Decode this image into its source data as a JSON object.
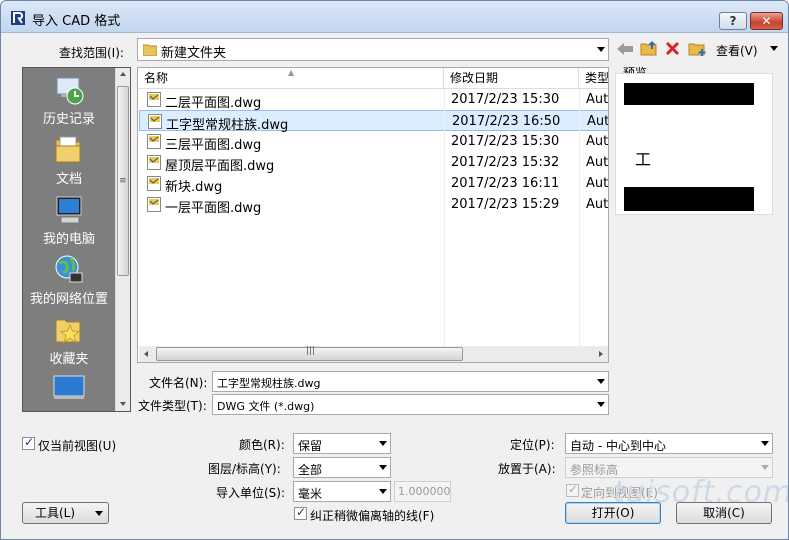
{
  "window": {
    "title": "导入 CAD 格式",
    "help_label": "?",
    "close_label": "✕"
  },
  "lookin": {
    "label": "查找范围(I):",
    "value": "新建文件夹",
    "view_label": "查看(V)"
  },
  "places": [
    {
      "label": "历史记录",
      "icon": "history-icon"
    },
    {
      "label": "文档",
      "icon": "documents-icon"
    },
    {
      "label": "我的电脑",
      "icon": "computer-icon"
    },
    {
      "label": "我的网络位置",
      "icon": "network-icon"
    },
    {
      "label": "收藏夹",
      "icon": "favorites-icon"
    }
  ],
  "filelist": {
    "columns": [
      "名称",
      "修改日期",
      "类型"
    ],
    "rows": [
      {
        "name": "二层平面图.dwg",
        "date": "2017/2/23 15:30",
        "type": "Auto"
      },
      {
        "name": "工字型常规柱族.dwg",
        "date": "2017/2/23 16:50",
        "type": "Auto"
      },
      {
        "name": "三层平面图.dwg",
        "date": "2017/2/23 15:30",
        "type": "Auto"
      },
      {
        "name": "屋顶层平面图.dwg",
        "date": "2017/2/23 15:32",
        "type": "Auto"
      },
      {
        "name": "新块.dwg",
        "date": "2017/2/23 16:11",
        "type": "Auto"
      },
      {
        "name": "一层平面图.dwg",
        "date": "2017/2/23 15:29",
        "type": "Auto"
      }
    ]
  },
  "preview": {
    "label": "预览",
    "glyph": "工"
  },
  "filename": {
    "label": "文件名(N):",
    "value": "工字型常规柱族.dwg"
  },
  "filetype": {
    "label": "文件类型(T):",
    "value": "DWG 文件 (*.dwg)"
  },
  "options": {
    "current_view_only": {
      "label": "仅当前视图(U)",
      "checked": true
    },
    "colors": {
      "label": "颜色(R):",
      "value": "保留"
    },
    "layers": {
      "label": "图层/标高(Y):",
      "value": "全部"
    },
    "import_units": {
      "label": "导入单位(S):",
      "value": "毫米",
      "factor": "1.000000"
    },
    "correct_lines": {
      "label": "纠正稍微偏离轴的线(F)",
      "checked": true
    },
    "positioning": {
      "label": "定位(P):",
      "value": "自动 - 中心到中心"
    },
    "place_at": {
      "label": "放置于(A):",
      "value": "参照标高"
    },
    "orient_to_view": {
      "label": "定向到视图(E)",
      "checked": true
    }
  },
  "buttons": {
    "tools": "工具(L)",
    "open": "打开(O)",
    "cancel": "取消(C)"
  },
  "watermark": "tuisoft.com",
  "colors": {
    "places_bg": "#7e7e7e",
    "selected_row": "#dbeeff",
    "title_bar": "#c2d6ee"
  }
}
